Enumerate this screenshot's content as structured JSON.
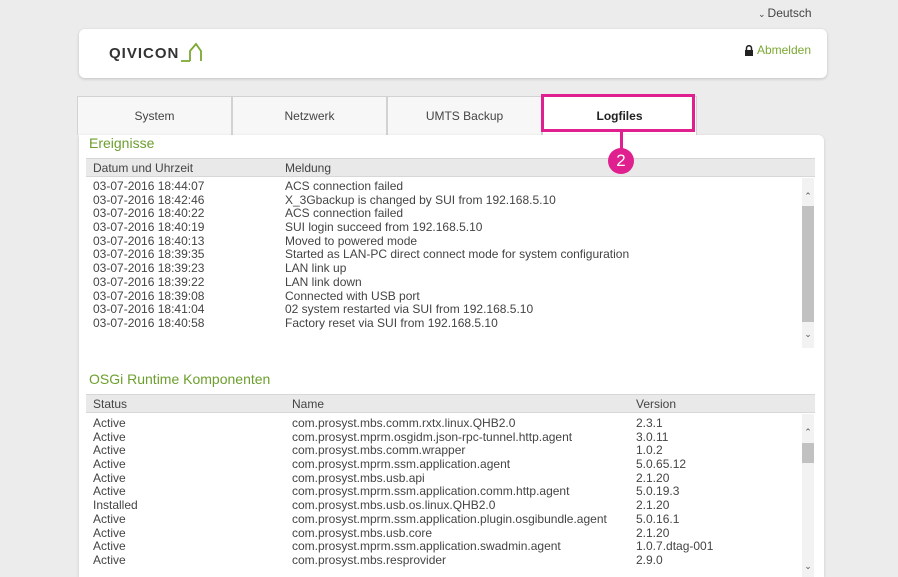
{
  "language": {
    "label": "Deutsch"
  },
  "header": {
    "logo_text": "QIVICON",
    "logout_label": "Abmelden"
  },
  "tabs": [
    {
      "label": "System"
    },
    {
      "label": "Netzwerk"
    },
    {
      "label": "UMTS Backup"
    },
    {
      "label": "Logfiles"
    }
  ],
  "callout": {
    "number": "2"
  },
  "events": {
    "title": "Ereignisse",
    "columns": [
      "Datum und Uhrzeit",
      "Meldung"
    ],
    "rows": [
      [
        "03-07-2016 18:44:07",
        "ACS connection failed"
      ],
      [
        "03-07-2016 18:42:46",
        "X_3Gbackup is changed by SUI from 192.168.5.10"
      ],
      [
        "03-07-2016 18:40:22",
        "ACS connection failed"
      ],
      [
        "03-07-2016 18:40:19",
        "SUI login succeed from 192.168.5.10"
      ],
      [
        "03-07-2016 18:40:13",
        "Moved to powered mode"
      ],
      [
        "03-07-2016 18:39:35",
        "Started as LAN-PC direct connect mode for system configuration"
      ],
      [
        "03-07-2016 18:39:23",
        "LAN link up"
      ],
      [
        "03-07-2016 18:39:22",
        "LAN link down"
      ],
      [
        "03-07-2016 18:39:08",
        "Connected with USB port"
      ],
      [
        "03-07-2016 18:41:04",
        "02 system restarted via SUI from 192.168.5.10"
      ],
      [
        "03-07-2016 18:40:58",
        "Factory reset via SUI from 192.168.5.10"
      ]
    ]
  },
  "components": {
    "title": "OSGi Runtime Komponenten",
    "columns": [
      "Status",
      "Name",
      "Version"
    ],
    "rows": [
      [
        "Active",
        "com.prosyst.mbs.comm.rxtx.linux.QHB2.0",
        "2.3.1"
      ],
      [
        "Active",
        "com.prosyst.mprm.osgidm.json-rpc-tunnel.http.agent",
        "3.0.11"
      ],
      [
        "Active",
        "com.prosyst.mbs.comm.wrapper",
        "1.0.2"
      ],
      [
        "Active",
        "com.prosyst.mprm.ssm.application.agent",
        "5.0.65.12"
      ],
      [
        "Active",
        "com.prosyst.mbs.usb.api",
        "2.1.20"
      ],
      [
        "Active",
        "com.prosyst.mprm.ssm.application.comm.http.agent",
        "5.0.19.3"
      ],
      [
        "Installed",
        "com.prosyst.mbs.usb.os.linux.QHB2.0",
        "2.1.20"
      ],
      [
        "Active",
        "com.prosyst.mprm.ssm.application.plugin.osgibundle.agent",
        "5.0.16.1"
      ],
      [
        "Active",
        "com.prosyst.mbs.usb.core",
        "2.1.20"
      ],
      [
        "Active",
        "com.prosyst.mprm.ssm.application.swadmin.agent",
        "1.0.7.dtag-001"
      ],
      [
        "Active",
        "com.prosyst.mbs.resprovider",
        "2.9.0"
      ]
    ]
  },
  "colors": {
    "accent": "#6d9f2e",
    "highlight": "#e0208e"
  }
}
